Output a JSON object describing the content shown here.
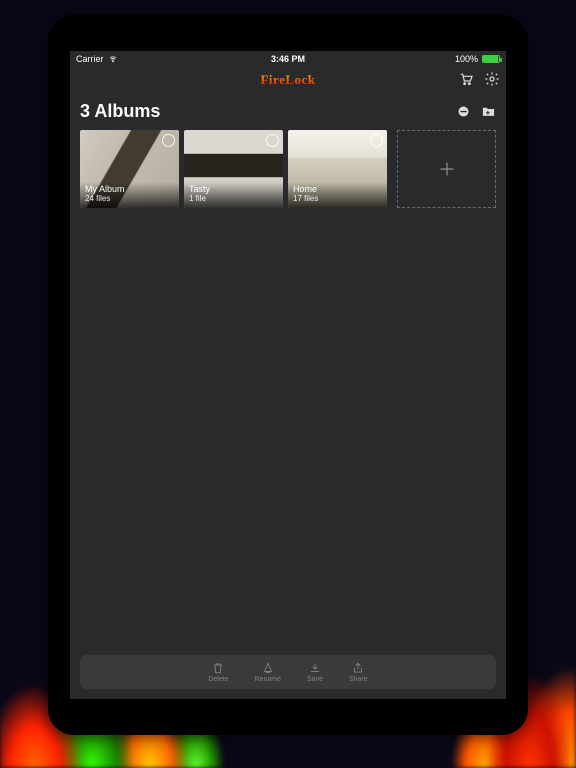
{
  "statusbar": {
    "carrier": "Carrier",
    "time": "3:46 PM",
    "battery": "100%"
  },
  "navbar": {
    "title": "FireLock"
  },
  "header": {
    "title": "3 Albums"
  },
  "albums": [
    {
      "name": "My Album",
      "files": "24 files"
    },
    {
      "name": "Tasty",
      "files": "1 file"
    },
    {
      "name": "Home",
      "files": "17 files"
    }
  ],
  "toolbar": {
    "delete": "Delete",
    "rename": "Rename",
    "save": "Save",
    "share": "Share"
  }
}
